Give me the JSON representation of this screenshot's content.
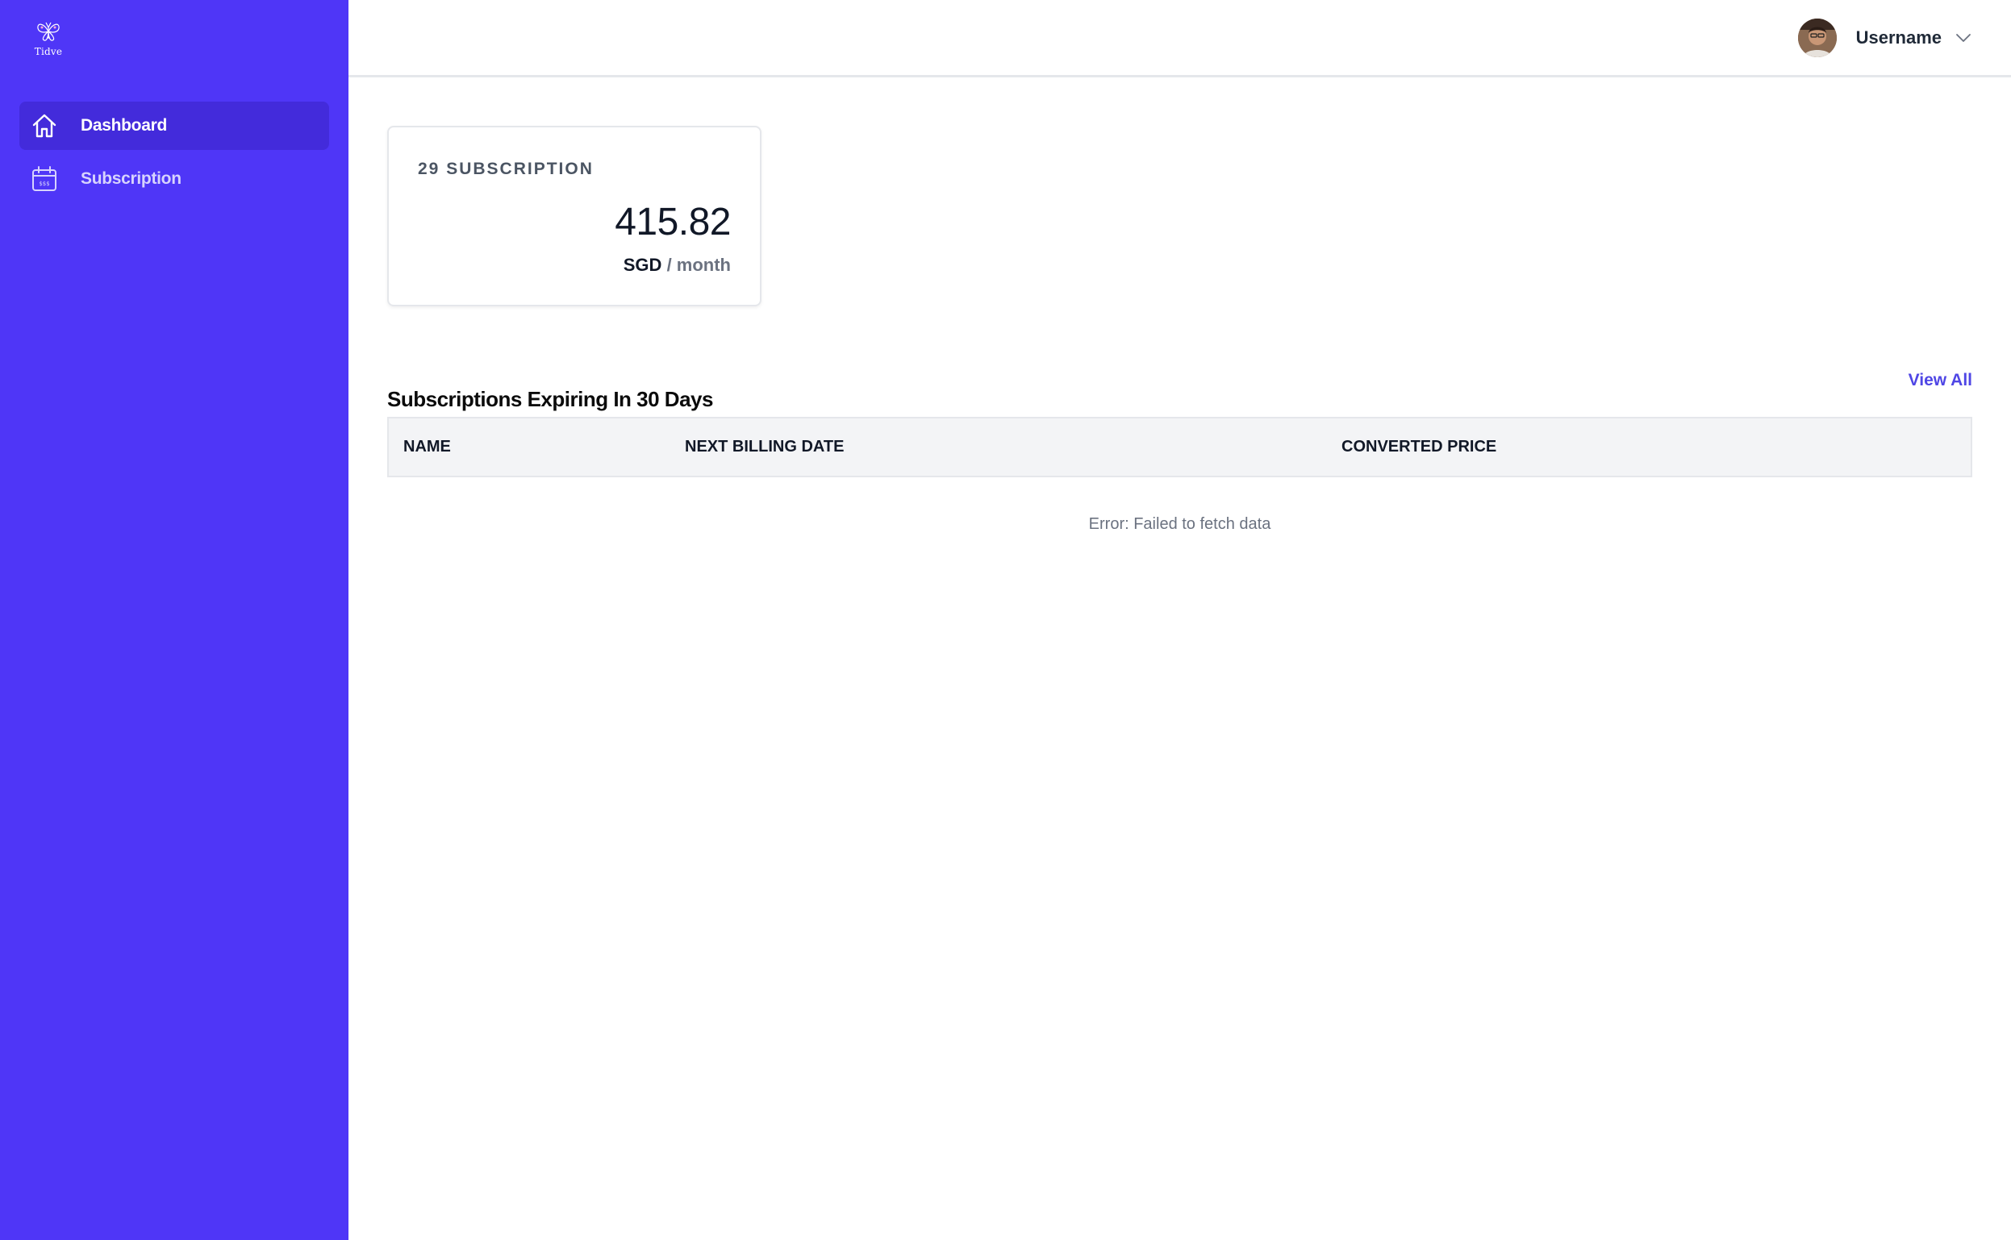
{
  "brand": {
    "name": "Tidve",
    "logo_icon": "butterfly-logo"
  },
  "sidebar": {
    "items": [
      {
        "label": "Dashboard",
        "icon": "home-icon",
        "active": true
      },
      {
        "label": "Subscription",
        "icon": "calendar-icon",
        "active": false
      }
    ]
  },
  "header": {
    "username": "Username",
    "avatar_icon": "avatar",
    "dropdown_icon": "chevron-down-icon"
  },
  "summary_card": {
    "title": "29 SUBSCRIPTION",
    "amount": "415.82",
    "currency": "SGD",
    "period": "/ month"
  },
  "expiring": {
    "title": "Subscriptions Expiring In 30 Days",
    "view_all_label": "View All",
    "columns": [
      "NAME",
      "NEXT BILLING DATE",
      "CONVERTED PRICE"
    ],
    "empty_message": "Error: Failed to fetch data"
  },
  "colors": {
    "sidebar_bg": "#4f36f7",
    "sidebar_active": "#432bdb",
    "accent": "#4f46e5",
    "table_header_bg": "#f3f4f6"
  }
}
